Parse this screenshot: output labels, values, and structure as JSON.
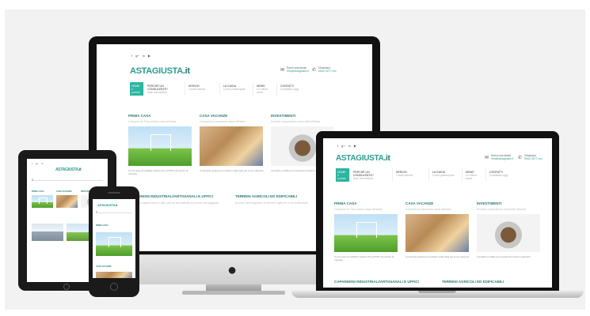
{
  "site": {
    "logo": "ASTAGIUSTA",
    "logo_tld": ".it",
    "social_icons": [
      "facebook-icon",
      "google-plus-icon",
      "linkedin-icon",
      "youtube-icon"
    ],
    "contact_email_label": "Scrivi una email",
    "contact_email": "info@astagiusta.it",
    "contact_phone_label": "Chiamaci",
    "contact_phone": "0542 0277 xxx",
    "nav": [
      {
        "label": "HOME",
        "sub": "Il portale"
      },
      {
        "label": "PERCHÈ UN CONSULENTE?",
        "sub": "Aste immobiliari"
      },
      {
        "label": "SERVIZI",
        "sub": "I nostri servizi"
      },
      {
        "label": "LA GUIDA",
        "sub": "Come partecipare"
      },
      {
        "label": "NEWS",
        "sub": "Le ultime news"
      },
      {
        "label": "CONTATTI",
        "sub": "Contattaci oggi"
      }
    ],
    "sections": [
      {
        "title": "PRIMA CASA",
        "subtitle": "Compra la Tua prima casa all'asta",
        "desc": "Con le aste immobiliari risparmi fino al 50% sul prezzo di mercato."
      },
      {
        "title": "CASA VACANZE",
        "subtitle": "Compra la seconda casa all'asta",
        "desc": "Il momento giusto per investire nella casa per le tue vacanze."
      },
      {
        "title": "INVESTIMENTI",
        "subtitle": "Investi comprando immobili all'asta",
        "desc": "Immobili a reddito per investimenti sicuri e garantiti."
      }
    ],
    "sections2": [
      {
        "title": "CAPANNONI INDUSTRIALI/ARTIGIANALI E UFFICI",
        "subtitle": "Acquista capannoni e uffici per la tua attività a prezzi vantaggiosi"
      },
      {
        "title": "TERRENI AGRICOLI ED EDIFICABILI",
        "subtitle": "Investi nell'acquisto di terreni agricoli o ed edificabili"
      }
    ]
  }
}
